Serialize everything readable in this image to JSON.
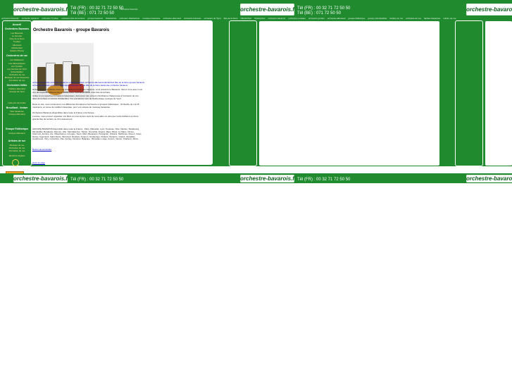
{
  "logo_text": "orchestre-bavarois.fr",
  "phone_fr": "Tél (FR) : 00 32 71 72 50 50",
  "phone_be": "Tél (BE) : 071 72 50 50",
  "top_small": "orchestre bavarois",
  "navline": [
    "orchestre bavarois",
    "orchestre bavarois",
    "orchestre Tyrolien",
    "orchestre fête de la bière",
    "groupe bavarois",
    "Oktoberfest",
    "orchestre Oktoberfest",
    "musique bavaroise",
    "orchestre allemand",
    "orchestre bavarois",
    "orchestre du Tyrol",
    "fête de la bière",
    "Oktoberfest",
    "Oktoberfest",
    "orchestre bavarois",
    "orchestre musique",
    "orchestre tyrolien",
    "orchestre allemand",
    "groupe folklorique",
    "groupe schuhplattler",
    "fanfare de rue",
    "orchestre de rue",
    "fanfare bavaroise",
    "culture de rue"
  ],
  "sidebar": {
    "home": "Accueil",
    "section1": "Orchestres Bavarois",
    "s1_items": [
      "Les Bavarois",
      "Le Groupe",
      "Fête de la bière",
      "Tyrolien",
      "Allemand",
      "Oktoberfest",
      "Galerie Photos"
    ],
    "section2": "Orchestres de rue",
    "s2_items": [
      "Les Waldeener",
      "Les Allémaniques",
      "Les Tyrolien",
      "Les Gamins du Tyrol",
      "Schuhplattler",
      "Orchestre de rue",
      "Musique de rue bavaroise",
      "Animation de rue",
      "Fanfare de rue"
    ],
    "section3": "Orchestres folklo",
    "s3_items": [
      "Folklore allemand",
      "Groupe de Tyrol"
    ],
    "s3b_items": [
      "Liste prix de la fête"
    ],
    "section4": "Brouillard - lindwe",
    "s4_items": [
      "Fête bavaroise",
      "Groupe Allemand"
    ],
    "section5": "Groupe Folklorique",
    "s5_items": [
      "Groupe Allemand"
    ],
    "section6": "Artistes de rue",
    "s6_items": [
      "Musique de rue",
      "Orchestre de rue",
      "Animation de rue"
    ],
    "s6b": "Mentions légales"
  },
  "main": {
    "title": "Orchestre Bavarois - groupe Bavarois",
    "link_rows": [
      "orchestre bavarois  orchestre bavarois  orchestre tyrolien  orchestre allemand  oktoberfest  fête de la bière  groupe bavarois  fanfare",
      "orchestre bavarois  orchestre folklorique  orchestre de rue  fête de la bière bavaroise  orchestre bavarois"
    ],
    "paragraphs": [
      "Notre équipe spécialisée dans les prestations d'orchestre bavarois, vous présente le Bavarois. Venez vivre avec nous une atmosphère chaleureuse et festive dans l'ambiance d'une vraie fête de la bière.",
      "Grâce à nos superbes formations bavaroises, découvrez des univers d'ambiance chaleureuse à l'occasion de vos fêtes de la bière et soirées Oktoberfest. Vos animations sont de l'authentique musique du Tyrol.",
      "Dans ce site, vous retrouverez nos différentes formations d'orchestre et groupes folkloriques : Orchestre de 4 à 15 musiciens, en tenue de tradition bavaroise, pour vos soirées de musique bavaroise.",
      "Orchestres Bavarois disponibles dans toute la France et la Suisse.",
      "L'année, vous pouvez organiser vos fêtes et nous serons ravis de vous aider ou retrouver notre fanfare lors d'une grande fête de la bière ou d'un événement.",
      "GROUPE BAVAROIS disponible dans toute la France : Paris, Marseille, Lyon, Toulouse, Nice, Nantes, Strasbourg, Montpellier, Bordeaux, Rennes, Lille, Saint-Etienne, Toulon, Grenoble, Angers, Dijon, Brest, Le Mans, Nîmes, Clermont, Amiens, Aix, Villeurbanne, Limoges, Tours, Metz, Besançon, Perpignan, Orléans, Mulhouse, Rouen, Caen, Nancy, Argenteuil, Saint-Denis, Montreuil, Roubaix, Avignon, Dunkerque, Poitiers, Nanterre, Créteil, Versailles, Courbevoie, Vitry, Colombes, Pau, Aulnay, Asnières. Belgique : Bruxelles, Liège, Anvers, Namur, Charleroi, Mons, Gand, Bruges, Ostende, Louvain."
    ],
    "back_link": "Retour au sommaire",
    "bottom_link": "Haut de page"
  }
}
